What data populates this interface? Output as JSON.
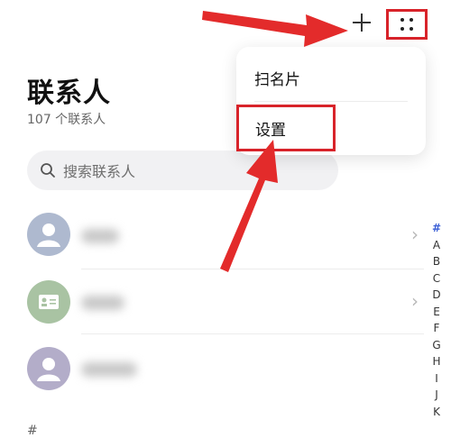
{
  "header": {
    "title": "联系人",
    "contact_count": "107 个联系人"
  },
  "search": {
    "placeholder": "搜索联系人"
  },
  "menu": {
    "items": [
      {
        "label": "扫名片"
      },
      {
        "label": "设置"
      }
    ]
  },
  "index_bar": {
    "letters": [
      "#",
      "A",
      "B",
      "C",
      "D",
      "E",
      "F",
      "G",
      "H",
      "I",
      "J",
      "K"
    ]
  },
  "list": {
    "section_label": "#"
  },
  "colors": {
    "highlight": "#d8232a",
    "index_active": "#3b5fd6",
    "search_bg": "#f1f1f3"
  },
  "icons": {
    "add": "plus-icon",
    "more": "more-dots-icon",
    "search": "search-icon",
    "chevron": "chevron-right-icon",
    "avatar_person": "person-avatar-icon",
    "avatar_card": "card-avatar-icon"
  }
}
